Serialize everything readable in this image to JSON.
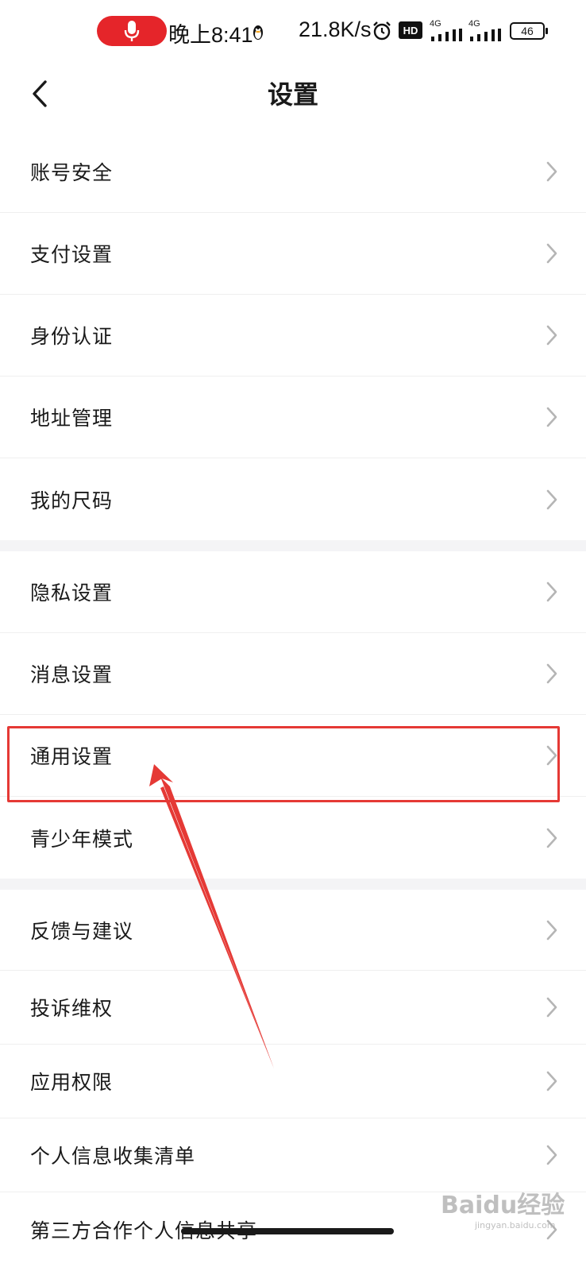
{
  "status_bar": {
    "time": "晚上8:41",
    "net_speed": "21.8K/s",
    "network_type_1": "4G",
    "network_type_2": "4G",
    "hd_label": "HD",
    "battery": "46",
    "accent_color": "#e5252a"
  },
  "header": {
    "title": "设置",
    "back_icon": "chevron-left-icon"
  },
  "groups": [
    {
      "items": [
        {
          "label": "账号安全"
        },
        {
          "label": "支付设置"
        },
        {
          "label": "身份认证"
        },
        {
          "label": "地址管理"
        },
        {
          "label": "我的尺码"
        }
      ]
    },
    {
      "items": [
        {
          "label": "隐私设置"
        },
        {
          "label": "消息设置"
        },
        {
          "label": "通用设置",
          "highlighted": true
        },
        {
          "label": "青少年模式"
        }
      ]
    },
    {
      "items": [
        {
          "label": "反馈与建议"
        },
        {
          "label": "投诉维权"
        },
        {
          "label": "应用权限"
        },
        {
          "label": "个人信息收集清单"
        },
        {
          "label": "第三方合作个人信息共享"
        }
      ]
    }
  ],
  "annotation": {
    "highlight_color": "#e53935"
  },
  "watermark": {
    "text": "Baidu经验",
    "sub": "jingyan.baidu.com"
  }
}
